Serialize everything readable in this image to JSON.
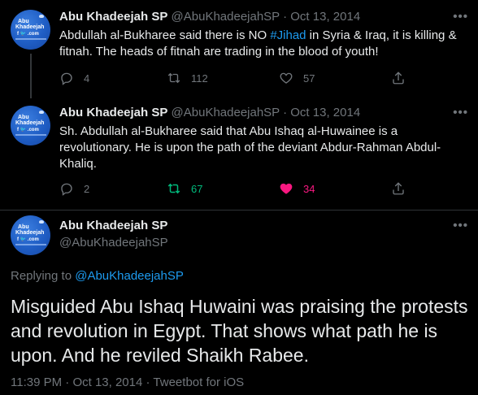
{
  "tweets": [
    {
      "name": "Abu Khadeejah SP",
      "handle": "@AbuKhadeejahSP",
      "sep": "·",
      "date": "Oct 13, 2014",
      "text_before": "Abdullah al-Bukharee said there is NO ",
      "hashtag": "#Jihad",
      "text_after": " in Syria & Iraq, it is killing & fitnah. The heads of fitnah are trading in the blood of youth!",
      "replies": "4",
      "retweets": "112",
      "likes": "57"
    },
    {
      "name": "Abu Khadeejah SP",
      "handle": "@AbuKhadeejahSP",
      "sep": "·",
      "date": "Oct 13, 2014",
      "text": "Sh. Abdullah al-Bukharee said that Abu Ishaq al-Huwainee is a revolutionary. He is upon the path of the deviant Abdur-Rahman Abdul-Khaliq.",
      "replies": "2",
      "retweets": "67",
      "likes": "34"
    }
  ],
  "main_tweet": {
    "name": "Abu Khadeejah SP",
    "handle": "@AbuKhadeejahSP",
    "replying_label": "Replying to ",
    "replying_handle": "@AbuKhadeejahSP",
    "text": "Misguided Abu Ishaq Huwaini was praising the protests and revolution in Egypt. That shows what path he is upon. And he reviled Shaikh Rabee.",
    "time": "11:39 PM",
    "sep": "·",
    "date": "Oct 13, 2014",
    "sep2": "·",
    "client": "Tweetbot for iOS"
  },
  "more_label": "•••",
  "avatar": {
    "line1": "Abu",
    "line2": "Khadeejah",
    "line3": "f 🐦 .com"
  },
  "icons": [
    "reply-icon",
    "retweet-icon",
    "like-icon",
    "share-icon",
    "more-icon"
  ],
  "colors": {
    "retweet_active": "#00ba7c",
    "like_active": "#f91880",
    "link": "#1d9bf0"
  }
}
